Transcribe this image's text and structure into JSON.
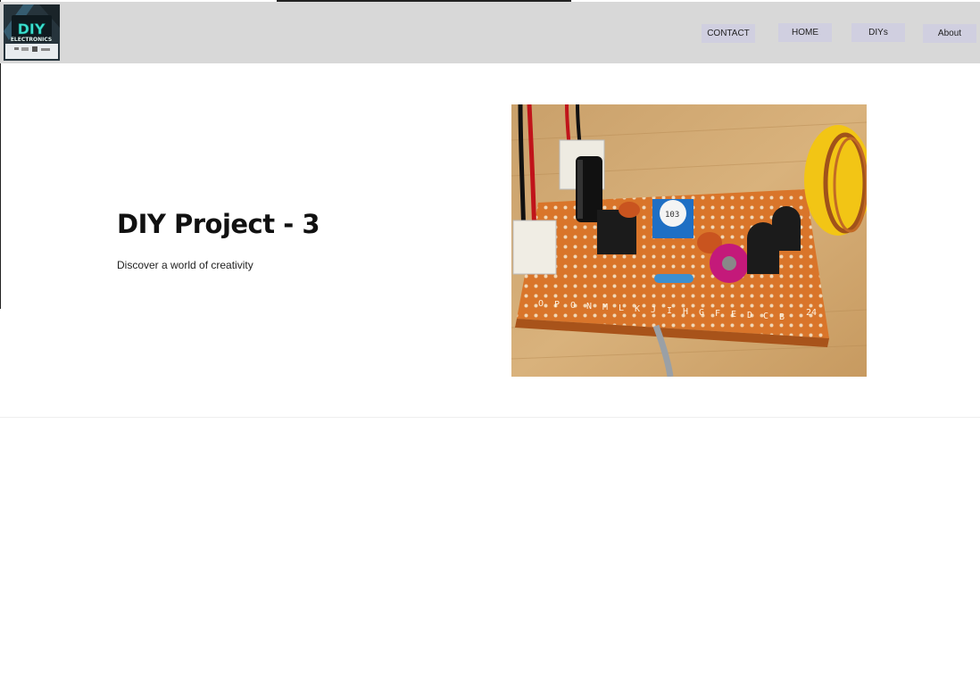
{
  "header": {
    "logo": {
      "text_lines": [
        "DIY",
        "ELECTRONICS"
      ]
    },
    "nav": [
      {
        "label": "CONTACT",
        "name": "nav-contact-button"
      },
      {
        "label": "HOME",
        "name": "nav-home-button"
      },
      {
        "label": "DIYs",
        "name": "nav-diys-button"
      },
      {
        "label": "About",
        "name": "nav-about-button"
      }
    ]
  },
  "hero": {
    "title": "DIY Project - 3",
    "subtitle": "Discover a world of creativity",
    "image": {
      "board_column_labels": [
        "O",
        "P",
        "O",
        "N",
        "M",
        "L",
        "K",
        "J",
        "I",
        "H",
        "G",
        "F",
        "E",
        "D",
        "C",
        "B"
      ],
      "board_row_number": "24",
      "trimmer_label": "103"
    }
  },
  "colors": {
    "nav_background": "#d8d8d8",
    "nav_button": "#d0cfe0",
    "page_background": "#ffffff"
  }
}
